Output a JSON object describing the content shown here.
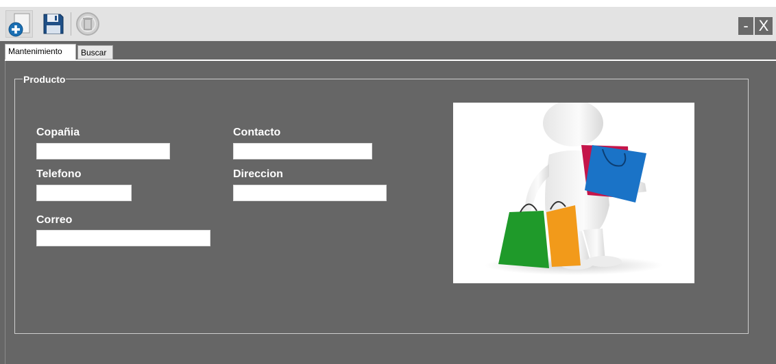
{
  "toolbar": {
    "new_icon": "add-new-icon",
    "save_icon": "floppy-disk-save-icon",
    "delete_icon": "trash-delete-icon-disabled"
  },
  "window_controls": {
    "minimize_label": "-",
    "close_label": "X"
  },
  "tabs": [
    {
      "label": "Mantenimiento",
      "active": true
    },
    {
      "label": "Buscar",
      "active": false
    }
  ],
  "group": {
    "title": "Producto"
  },
  "form": {
    "compania": {
      "label": "Copañia",
      "value": ""
    },
    "contacto": {
      "label": "Contacto",
      "value": ""
    },
    "telefono": {
      "label": "Telefono",
      "value": ""
    },
    "direccion": {
      "label": "Direccion",
      "value": ""
    },
    "correo": {
      "label": "Correo",
      "value": ""
    }
  },
  "image": {
    "icon": "shopping-person-with-bags"
  },
  "colors": {
    "background": "#666666",
    "toolbar": "#e3e3e3",
    "field": "#ffffff",
    "label": "#ffffff"
  }
}
